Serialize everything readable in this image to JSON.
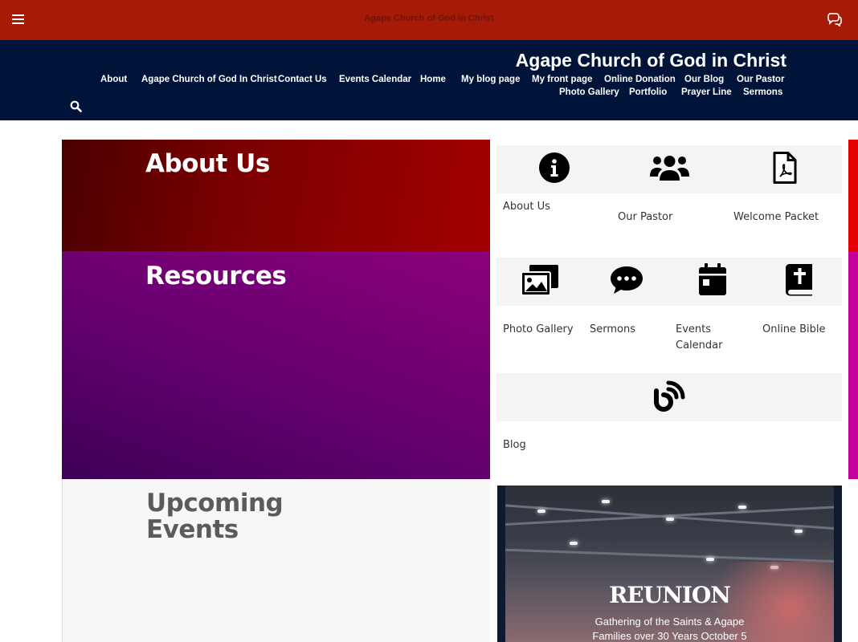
{
  "topbar": {
    "title": "Agape Church of God In Christ",
    "menu_icon": "hamburger-menu-icon",
    "chat_icon": "chat-bubbles-icon",
    "bg_color": "#a61a08"
  },
  "header": {
    "site_title": "Agape Church of God in Christ",
    "bg_color": "#001338",
    "search_icon": "search-icon",
    "nav": [
      "About",
      "Agape Church of God In Christ",
      "Contact Us",
      "Events Calendar",
      "Home",
      "My blog page",
      "My front page",
      "Online Donation",
      "Our Blog",
      "Our Pastor",
      "Photo Gallery",
      "Portfolio",
      "Prayer Line",
      "Sermons"
    ]
  },
  "about": {
    "heading": "About Us",
    "tiles": [
      {
        "label": "About Us",
        "icon": "info-circle-icon"
      },
      {
        "label": "Our Pastor",
        "icon": "users-group-icon"
      },
      {
        "label": "Welcome Packet",
        "icon": "pdf-file-icon"
      }
    ]
  },
  "resources": {
    "heading": "Resources",
    "tiles": [
      {
        "label": "Photo Gallery",
        "icon": "photo-gallery-icon"
      },
      {
        "label": "Sermons",
        "icon": "speech-bubble-icon"
      },
      {
        "label": "Events Calendar",
        "icon": "calendar-icon"
      },
      {
        "label": "Online Bible",
        "icon": "bible-icon"
      },
      {
        "label": "Blog",
        "icon": "blog-icon"
      }
    ]
  },
  "events": {
    "heading": "Upcoming Events",
    "card": {
      "title": "REUNION",
      "subtitle_line1": "Gathering of the Saints & Agape",
      "subtitle_line2": "Families over 30 Years October 5"
    }
  }
}
